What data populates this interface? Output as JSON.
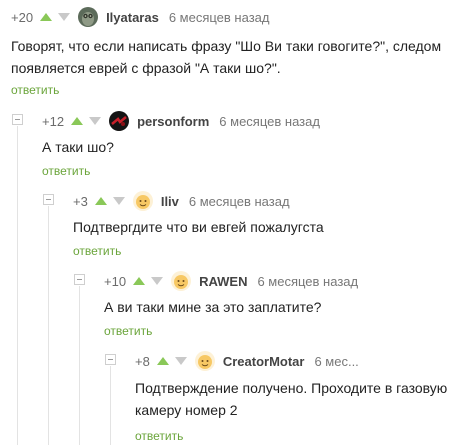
{
  "comments": [
    {
      "rating": "+20",
      "username": "Ilyataras",
      "date": "6 месяцев назад",
      "text": "Говорят, что если написать фразу \"Шо Ви таки говогите?\", следом появляется еврей с фразой \"А таки шо?\".",
      "reply": "ответить",
      "avatar_icon": "owl-avatar-icon"
    },
    {
      "rating": "+12",
      "username": "personform",
      "date": "6 месяцев назад",
      "text": "А таки шо?",
      "reply": "ответить",
      "avatar_icon": "dark-red-avatar-icon"
    },
    {
      "rating": "+3",
      "username": "Iliv",
      "date": "6 месяцев назад",
      "text": "Подтвергдите что ви евгей пожалугста",
      "reply": "ответить",
      "avatar_icon": "default-smile-avatar-icon"
    },
    {
      "rating": "+10",
      "username": "RAWEN",
      "date": "6 месяцев назад",
      "text": "А ви таки мине за это заплатите?",
      "reply": "ответить",
      "avatar_icon": "default-smile-avatar-icon"
    },
    {
      "rating": "+8",
      "username": "CreatorMotar",
      "date": "6 мес...",
      "text": "Подтверждение получено. Проходите в газовую камеру номер 2",
      "reply": "ответить",
      "avatar_icon": "default-smile-avatar-icon"
    }
  ],
  "colors": {
    "vote_up": "#8ac858",
    "vote_down": "#c9c9c9",
    "reply_link": "#6aa43a",
    "thread_line": "#e3e3e3"
  }
}
